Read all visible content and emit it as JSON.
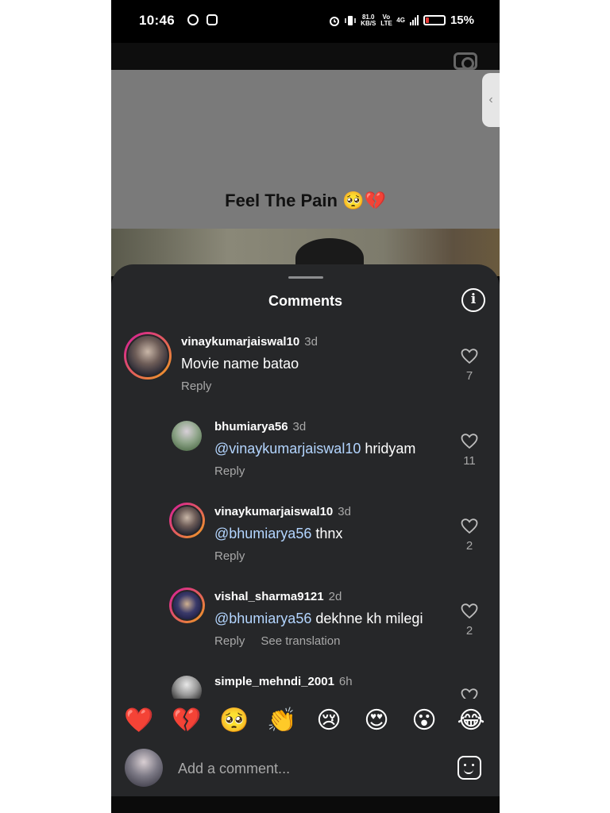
{
  "status_bar": {
    "time": "10:46",
    "speed_value": "81.0",
    "speed_unit": "KB/S",
    "volte": "Vo LTE",
    "network": "4G",
    "battery": "15%"
  },
  "reel": {
    "caption": "Feel The Pain 🥺💔"
  },
  "sheet": {
    "title": "Comments"
  },
  "comments": [
    {
      "username": "vinaykumarjaiswal10",
      "time": "3d",
      "mention": "",
      "text": "Movie name batao",
      "reply_label": "Reply",
      "likes": "7"
    },
    {
      "username": "bhumiarya56",
      "time": "3d",
      "mention": "@vinaykumarjaiswal10",
      "text": "hridyam",
      "reply_label": "Reply",
      "likes": "11"
    },
    {
      "username": "vinaykumarjaiswal10",
      "time": "3d",
      "mention": "@bhumiarya56",
      "text": "thnx",
      "reply_label": "Reply",
      "likes": "2"
    },
    {
      "username": "vishal_sharma9121",
      "time": "2d",
      "mention": "@bhumiarya56",
      "text": "dekhne kh milegi",
      "reply_label": "Reply",
      "translation_label": "See translation",
      "likes": "2"
    },
    {
      "username": "simple_mehndi_2001",
      "time": "6h"
    }
  ],
  "reactions": [
    "❤️",
    "💔",
    "🥺",
    "👏",
    "😢",
    "😍",
    "😮",
    "😂"
  ],
  "composer": {
    "placeholder": "Add a comment..."
  }
}
